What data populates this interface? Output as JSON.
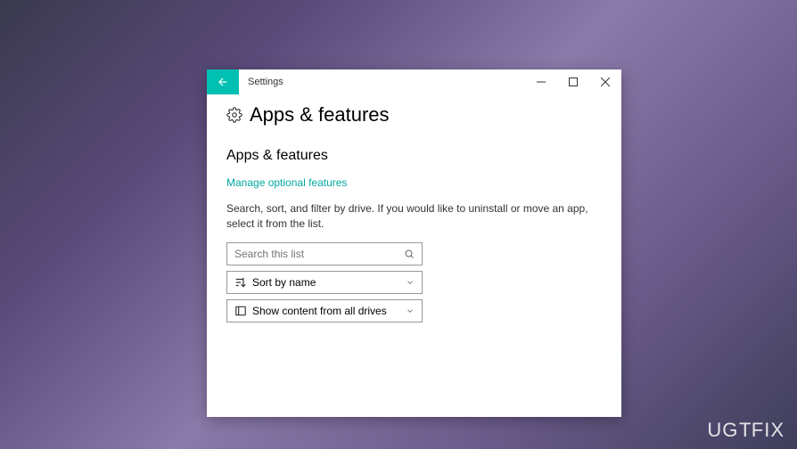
{
  "window": {
    "title": "Settings"
  },
  "page": {
    "heading": "Apps & features",
    "section_heading": "Apps & features",
    "link": "Manage optional features",
    "description": "Search, sort, and filter by drive. If you would like to uninstall or move an app, select it from the list."
  },
  "search": {
    "placeholder": "Search this list"
  },
  "sort": {
    "label": "Sort by name"
  },
  "filter": {
    "label": "Show content from all drives"
  },
  "watermark": {
    "text_part1": "UG",
    "text_part2": "T",
    "text_part3": "FIX"
  }
}
